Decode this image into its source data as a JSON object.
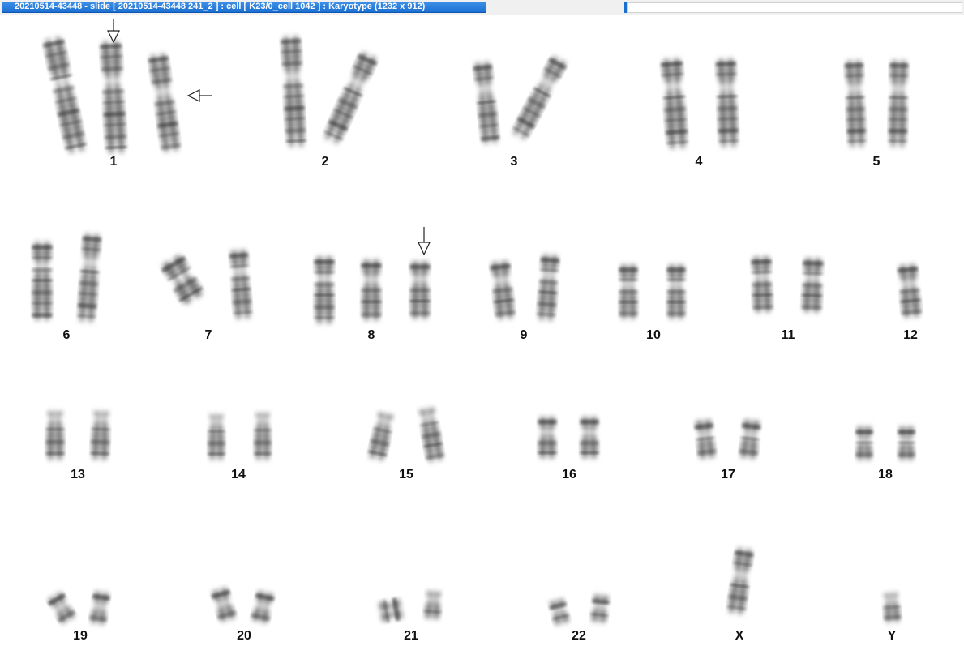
{
  "window": {
    "title": "20210514-43448 - slide [ 20210514-43448 241_2 ] : cell [ K23/0_cell 1042 ] : Karyotype  (1232 x 912)"
  },
  "karyotype": {
    "labels": [
      "1",
      "2",
      "3",
      "4",
      "5",
      "6",
      "7",
      "8",
      "9",
      "10",
      "11",
      "12",
      "13",
      "14",
      "15",
      "16",
      "17",
      "18",
      "19",
      "20",
      "21",
      "22",
      "X",
      "Y"
    ]
  }
}
